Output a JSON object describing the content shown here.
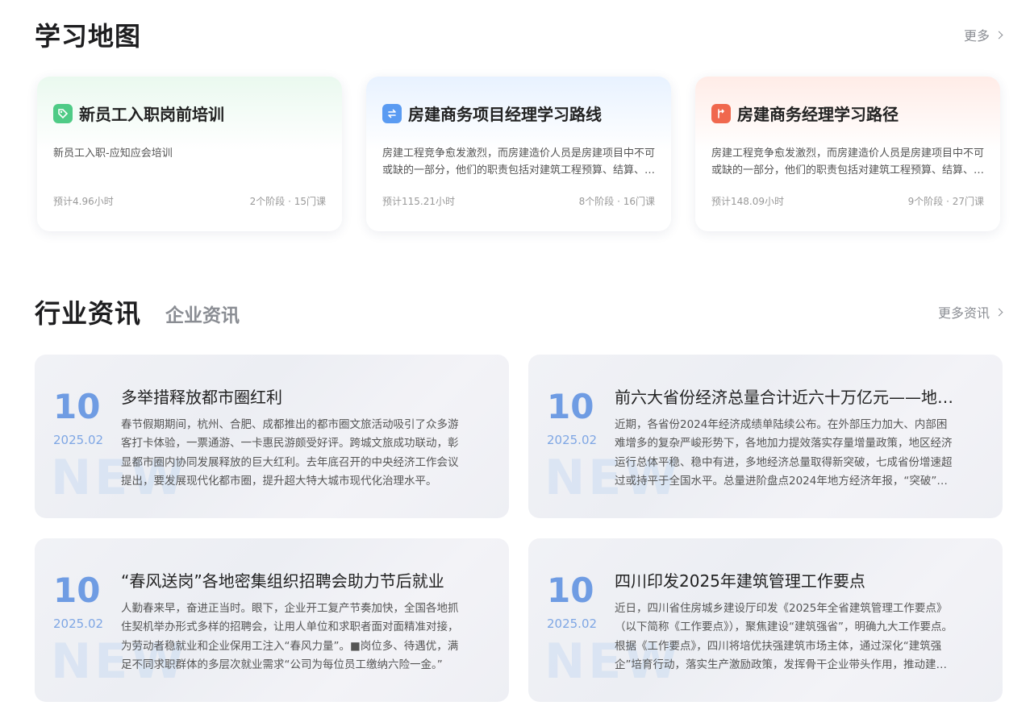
{
  "learning_map": {
    "title": "学习地图",
    "more_label": "更多",
    "cards": [
      {
        "icon": "tag-icon",
        "title": "新员工入职岗前培训",
        "description": "新员工入职-应知应会培训",
        "duration": "预计4.96小时",
        "meta": "2个阶段 · 15门课"
      },
      {
        "icon": "swap-icon",
        "title": "房建商务项目经理学习路线",
        "description": "房建工程竞争愈发激烈，而房建造价人员是房建项目中不可或缺的一部分，他们的职责包括对建筑工程预算、结算、成本控制等进行全面管理。",
        "duration": "预计115.21小时",
        "meta": "8个阶段 · 16门课"
      },
      {
        "icon": "route-icon",
        "title": "房建商务经理学习路径",
        "description": "房建工程竞争愈发激烈，而房建造价人员是房建项目中不可或缺的一部分，他们的职责包括对建筑工程预算、结算、成本控制等进行全面管理。",
        "duration": "预计148.09小时",
        "meta": "9个阶段 · 27门课"
      }
    ]
  },
  "news": {
    "tabs": [
      "行业资讯",
      "企业资讯"
    ],
    "more_label": "更多资讯",
    "watermark": "NEW",
    "items": [
      {
        "day": "10",
        "date": "2025.02",
        "title": "多举措释放都市圈红利",
        "body": "春节假期期间，杭州、合肥、成都推出的都市圈文旅活动吸引了众多游客打卡体验，一票通游、一卡惠民游颇受好评。跨城文旅成功联动，彰显都市圈内协同发展释放的巨大红利。去年底召开的中央经济工作会议提出，要发展现代化都市圈，提升超大特大城市现代化治理水平。"
      },
      {
        "day": "10",
        "date": "2025.02",
        "title": "前六大省份经济总量合计近六十万亿元——地方经济年报观察",
        "body": "近期，各省份2024年经济成绩单陆续公布。在外部压力加大、内部困难增多的复杂严峻形势下，各地加力提效落实存量增量政策，地区经济运行总体平稳、稳中有进，多地经济总量取得新突破，七成省份增速超过或持平于全国水平。总量进阶盘点2024年地方经济年报，“突破”成为关键词。"
      },
      {
        "day": "10",
        "date": "2025.02",
        "title": "“春风送岗”各地密集组织招聘会助力节后就业",
        "body": "人勤春来早，奋进正当时。眼下，企业开工复产节奏加快，全国各地抓住契机举办形式多样的招聘会，让用人单位和求职者面对面精准对接，为劳动者稳就业和企业保用工注入“春风力量”。■岗位多、待遇优，满足不同求职群体的多层次就业需求“公司为每位员工缴纳六险一金。”"
      },
      {
        "day": "10",
        "date": "2025.02",
        "title": "四川印发2025年建筑管理工作要点",
        "body": "近日，四川省住房城乡建设厅印发《2025年全省建筑管理工作要点》（以下简称《工作要点》），聚焦建设“建筑强省”，明确九大工作要点。根据《工作要点》，四川将培优扶强建筑市场主体，通过深化“建筑强企”培育行动，落实生产激励政策，发挥骨干企业带头作用，推动建筑业高质量发展。"
      }
    ]
  }
}
